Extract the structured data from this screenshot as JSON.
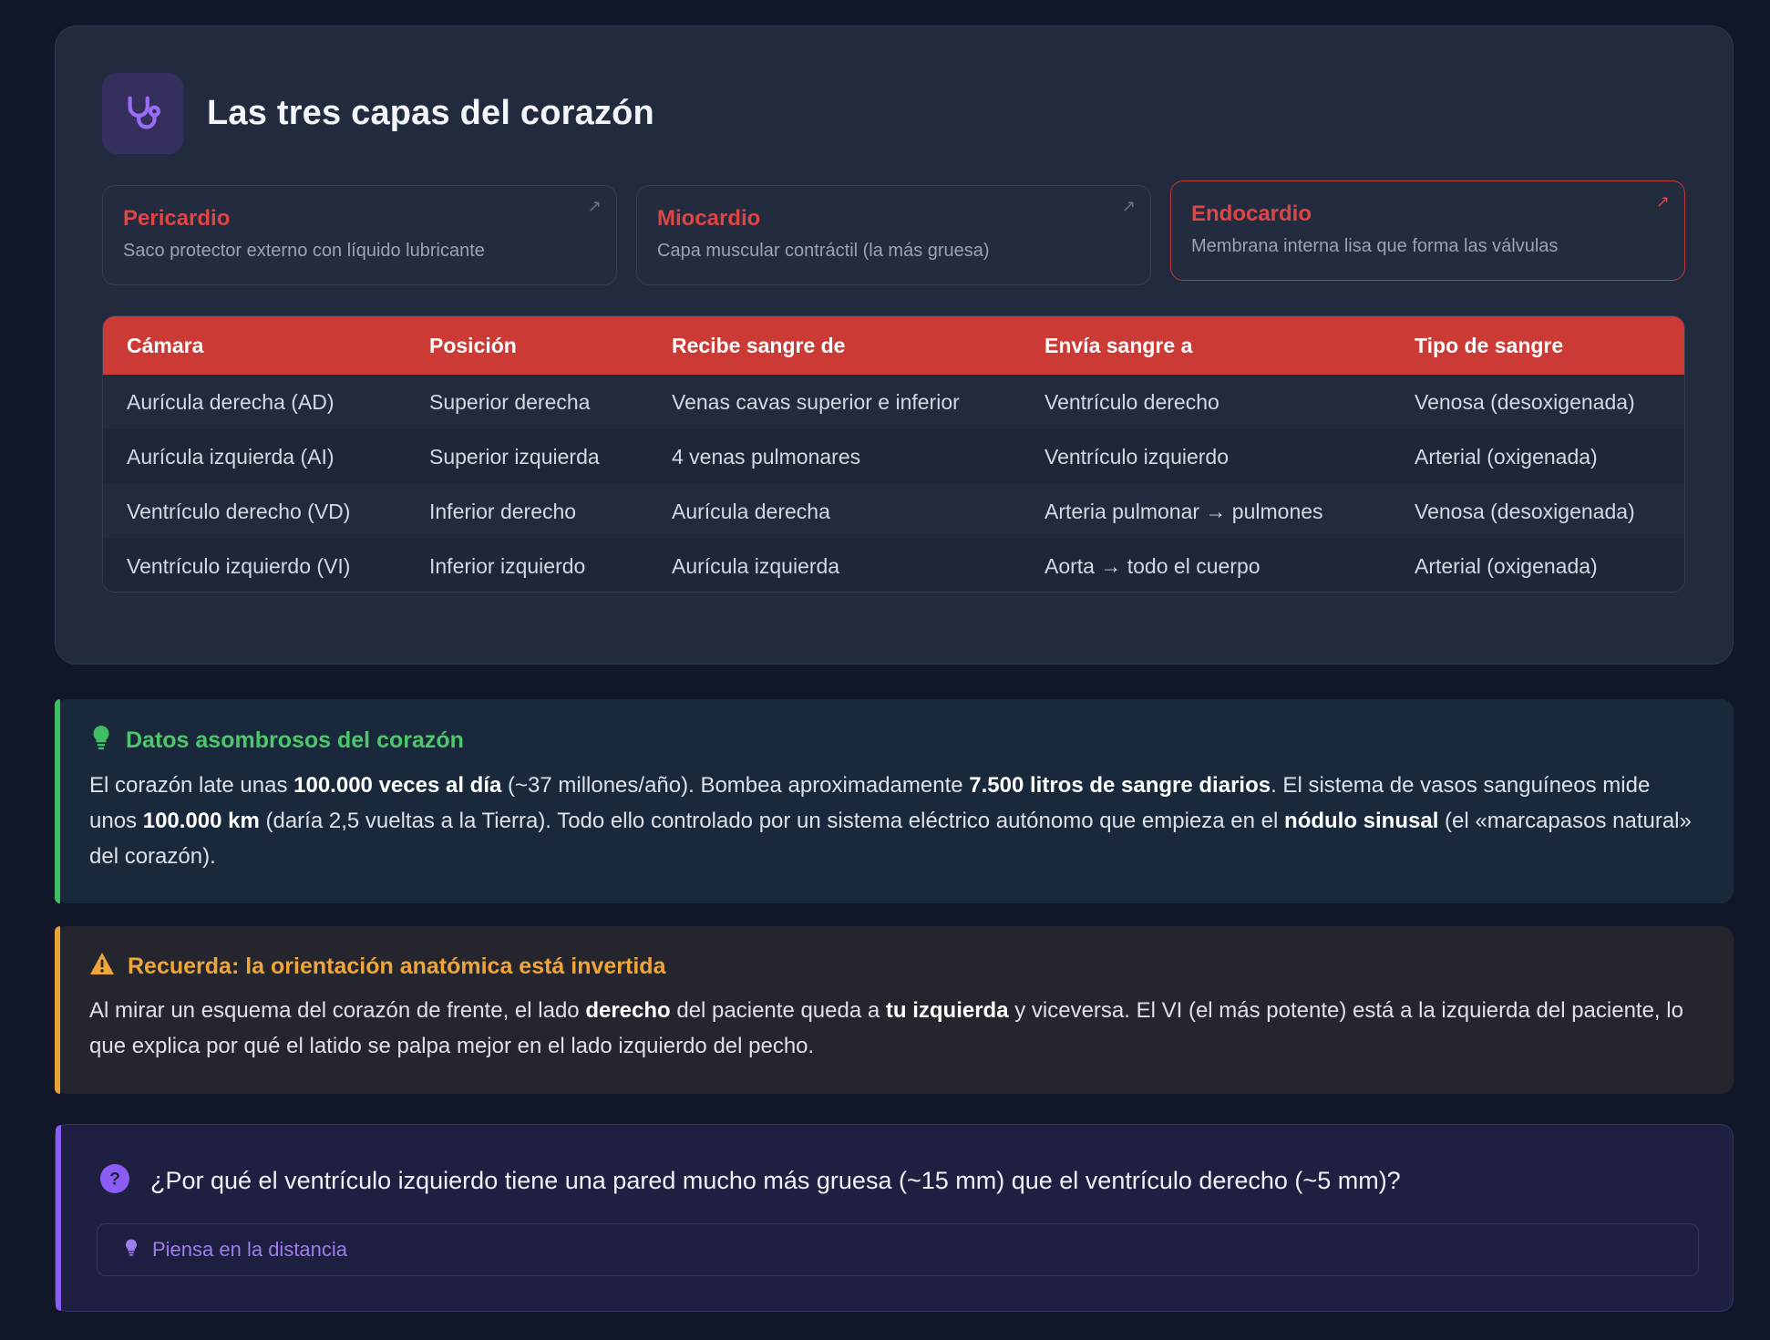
{
  "card": {
    "icon": "stethoscope-icon",
    "title": "Las tres capas del corazón",
    "layers": [
      {
        "name": "Pericardio",
        "desc": "Saco protector externo con líquido lubricante",
        "arrow": "↗"
      },
      {
        "name": "Miocardio",
        "desc": "Capa muscular contráctil (la más gruesa)",
        "arrow": "↗"
      },
      {
        "name": "Endocardio",
        "desc": "Membrana interna lisa que forma las válvulas",
        "arrow": "↗"
      }
    ],
    "table": {
      "headers": [
        "Cámara",
        "Posición",
        "Recibe sangre de",
        "Envía sangre a",
        "Tipo de sangre"
      ],
      "rows": [
        [
          "Aurícula derecha (AD)",
          "Superior derecha",
          "Venas cavas superior e inferior",
          "Ventrículo derecho",
          "Venosa (desoxigenada)"
        ],
        [
          "Aurícula izquierda (AI)",
          "Superior izquierda",
          "4 venas pulmonares",
          "Ventrículo izquierdo",
          "Arterial (oxigenada)"
        ],
        [
          "Ventrículo derecho (VD)",
          "Inferior derecho",
          "Aurícula derecha",
          "Arteria pulmonar → pulmones",
          "Venosa (desoxigenada)"
        ],
        [
          "Ventrículo izquierdo (VI)",
          "Inferior izquierdo",
          "Aurícula izquierda",
          "Aorta → todo el cuerpo",
          "Arterial (oxigenada)"
        ]
      ]
    }
  },
  "facts": {
    "icon": "lightbulb-icon",
    "title": "Datos asombrosos del corazón",
    "p1": "El corazón late unas ",
    "b1": "100.000 veces al día",
    "p2": " (~37 millones/año). Bombea aproximadamente ",
    "b2": "7.500 litros de sangre diarios",
    "p3": ". El sistema de vasos sanguíneos mide unos ",
    "b3": "100.000 km",
    "p4": " (daría 2,5 vueltas a la Tierra). Todo ello controlado por un sistema eléctrico autónomo que empieza en el ",
    "b4": "nódulo sinusal",
    "p5": " (el «marcapasos natural» del corazón)."
  },
  "warning": {
    "icon": "warning-icon",
    "title": "Recuerda: la orientación anatómica está invertida",
    "p1": "Al mirar un esquema del corazón de frente, el lado ",
    "b1": "derecho",
    "p2": " del paciente queda a ",
    "b2": "tu izquierda",
    "p3": " y viceversa. El VI (el más potente) está a la izquierda del paciente, lo que explica por qué el latido se palpa mejor en el lado izquierdo del pecho."
  },
  "quiz": {
    "icon": "question-icon",
    "question": "¿Por qué el ventrículo izquierdo tiene una pared mucho más gruesa (~15 mm) que el ventrículo derecho (~5 mm)?",
    "hint_icon": "lightbulb-icon",
    "hint": "Piensa en la distancia"
  }
}
